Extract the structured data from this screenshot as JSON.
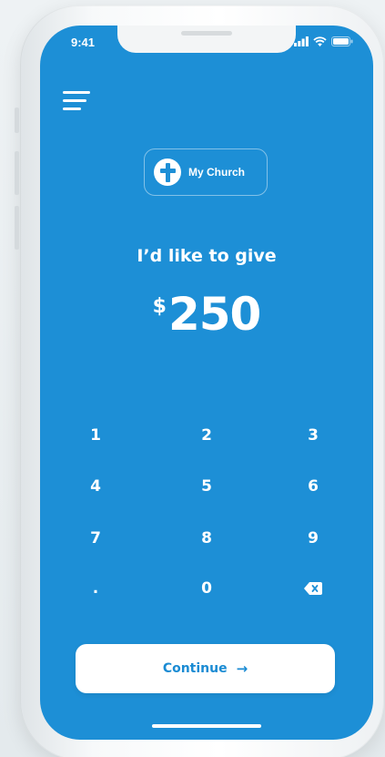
{
  "status_bar": {
    "time": "9:41",
    "icons": [
      "cellular-signal-icon",
      "wifi-icon",
      "battery-icon"
    ]
  },
  "header": {
    "menu_icon": "hamburger-menu-icon"
  },
  "church_selector": {
    "icon": "cross-icon",
    "label": "My Church"
  },
  "give": {
    "label": "I’d like to give",
    "currency": "$",
    "amount": "250"
  },
  "keypad": {
    "keys": [
      "1",
      "2",
      "3",
      "4",
      "5",
      "6",
      "7",
      "8",
      "9",
      ".",
      "0"
    ],
    "backspace_icon": "backspace-icon"
  },
  "continue": {
    "label": "Continue",
    "arrow": "→"
  },
  "colors": {
    "accent": "#1d8fd6",
    "button_bg": "#ffffff",
    "button_text": "#1a8bd3",
    "frame": "#f3f5f6"
  }
}
